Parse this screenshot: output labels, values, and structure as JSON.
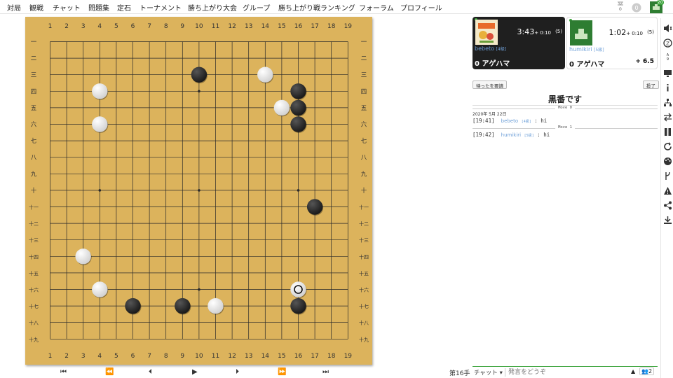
{
  "nav": {
    "items": [
      "対局",
      "観戦",
      "チャット",
      "問題集",
      "定石",
      "トーナメント",
      "勝ち上がり大会",
      "グループ",
      "勝ち上がり戦ランキング",
      "フォーラム",
      "プロフィール"
    ],
    "notification_count": "0",
    "avatar_badge": "20",
    "icons": [
      "notification-icon",
      "settings-circle-icon",
      "user-avatar-icon"
    ]
  },
  "board": {
    "size": 19,
    "col_labels": [
      "1",
      "2",
      "3",
      "4",
      "5",
      "6",
      "7",
      "8",
      "9",
      "10",
      "11",
      "12",
      "13",
      "14",
      "15",
      "16",
      "17",
      "18",
      "19"
    ],
    "row_labels": [
      "一",
      "二",
      "三",
      "四",
      "五",
      "六",
      "七",
      "八",
      "九",
      "十",
      "十一",
      "十二",
      "十三",
      "十四",
      "十五",
      "十六",
      "十七",
      "十八",
      "十九"
    ],
    "star_points": [
      [
        4,
        4
      ],
      [
        10,
        4
      ],
      [
        16,
        4
      ],
      [
        4,
        10
      ],
      [
        10,
        10
      ],
      [
        16,
        10
      ],
      [
        4,
        16
      ],
      [
        10,
        16
      ],
      [
        16,
        16
      ]
    ],
    "stones": [
      {
        "col": 10,
        "row": 3,
        "color": "black"
      },
      {
        "col": 14,
        "row": 3,
        "color": "white"
      },
      {
        "col": 4,
        "row": 4,
        "color": "white"
      },
      {
        "col": 16,
        "row": 4,
        "color": "black"
      },
      {
        "col": 15,
        "row": 5,
        "color": "white"
      },
      {
        "col": 16,
        "row": 5,
        "color": "black"
      },
      {
        "col": 4,
        "row": 6,
        "color": "white"
      },
      {
        "col": 16,
        "row": 6,
        "color": "black"
      },
      {
        "col": 17,
        "row": 11,
        "color": "black"
      },
      {
        "col": 3,
        "row": 14,
        "color": "white"
      },
      {
        "col": 4,
        "row": 16,
        "color": "white"
      },
      {
        "col": 16,
        "row": 16,
        "color": "white",
        "last_move": true
      },
      {
        "col": 6,
        "row": 17,
        "color": "black"
      },
      {
        "col": 9,
        "row": 17,
        "color": "black"
      },
      {
        "col": 11,
        "row": 17,
        "color": "white"
      },
      {
        "col": 16,
        "row": 17,
        "color": "black"
      }
    ],
    "colors": {
      "wood": "#dcb35c",
      "line": "#2a2a2a",
      "black_stone": "#1a1a1a",
      "white_stone": "#f4f4f4"
    }
  },
  "controls": [
    "⏮",
    "⏪",
    "⏴",
    "▶",
    "⏵",
    "⏩",
    "⏭"
  ],
  "players": {
    "black": {
      "name": "bebeto",
      "rank": "[4級]",
      "clock": "3:43",
      "byoyomi": "+ 0:10",
      "periods": "(5)",
      "captures": "0 アゲハマ"
    },
    "white": {
      "name": "humikiri",
      "rank": "[5級]",
      "clock": "1:02",
      "byoyomi": "+ 0:10",
      "periods": "(5)",
      "captures": "0 アゲハマ",
      "komi": "+ 6.5"
    }
  },
  "buttons": {
    "undo_request": "待ったを要請",
    "resign": "投了"
  },
  "status": {
    "turn_text": "黒番です",
    "move_number": "第16手"
  },
  "chat": {
    "date": "2020年 5月 22日",
    "entries": [
      {
        "move_label": "Move 0",
        "time": "[19:41]",
        "user": "bebeto",
        "rank": "[4級]",
        "message": ": hi"
      },
      {
        "move_label": "Move 1",
        "time": "[19:42]",
        "user": "humikiri",
        "rank": "[5級]",
        "message": ": hi"
      }
    ],
    "channel_label": "チャット ▾",
    "input_placeholder": "発言をどうぞ",
    "users_count": "2"
  },
  "sidebar_icons": [
    "mute-icon",
    "zen-mode-icon",
    "font-size-icon",
    "present-icon",
    "info-icon",
    "tree-icon",
    "swap-icon",
    "pause-icon",
    "refresh-icon",
    "palette-icon",
    "fork-icon",
    "report-icon",
    "share-icon",
    "download-icon"
  ],
  "accent": "#3ba33b"
}
